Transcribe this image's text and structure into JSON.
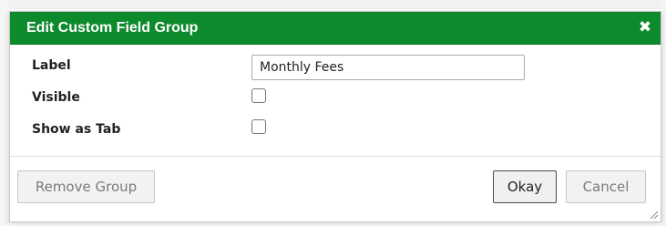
{
  "dialog": {
    "title": "Edit Custom Field Group",
    "close_symbol": "✖",
    "close_icon": "close-icon",
    "header_color": "#0d8a2c"
  },
  "form": {
    "label_field": {
      "label": "Label",
      "value": "Monthly Fees"
    },
    "visible_field": {
      "label": "Visible",
      "checked": false
    },
    "show_as_tab_field": {
      "label": "Show as Tab",
      "checked": false
    }
  },
  "footer": {
    "remove_label": "Remove Group",
    "okay_label": "Okay",
    "cancel_label": "Cancel"
  }
}
